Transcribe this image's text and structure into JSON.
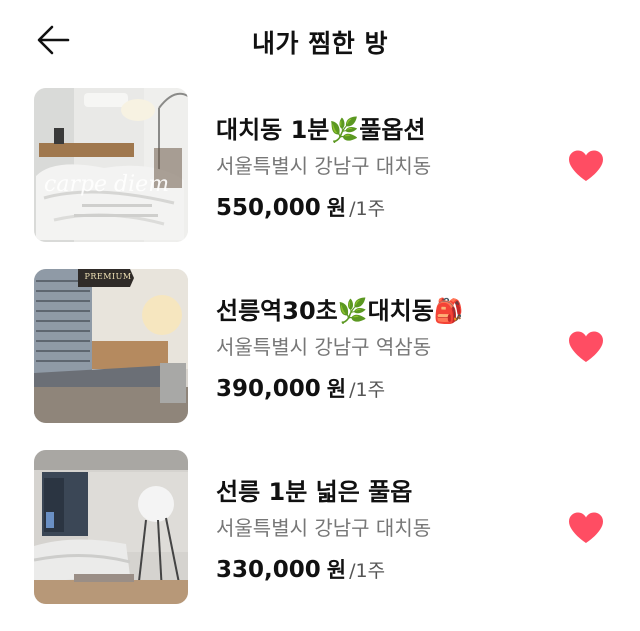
{
  "header": {
    "title": "내가 찜한 방",
    "back_icon": "arrow-left-icon"
  },
  "accent_color": "#ff4d63",
  "rooms": [
    {
      "title": "대치동 1분🌿풀옵션",
      "address": "서울특별시 강남구 대치동",
      "price": "550,000",
      "currency": "원",
      "period": "/1주",
      "liked": true,
      "thumbnail_overlay": "carpe diem"
    },
    {
      "title": "선릉역30초🌿대치동🎒",
      "address": "서울특별시 강남구 역삼동",
      "price": "390,000",
      "currency": "원",
      "period": "/1주",
      "liked": true,
      "thumbnail_badge": "PREMIUM"
    },
    {
      "title": "선릉 1분 넓은 풀옵",
      "address": "서울특별시 강남구 대치동",
      "price": "330,000",
      "currency": "원",
      "period": "/1주",
      "liked": true
    }
  ]
}
